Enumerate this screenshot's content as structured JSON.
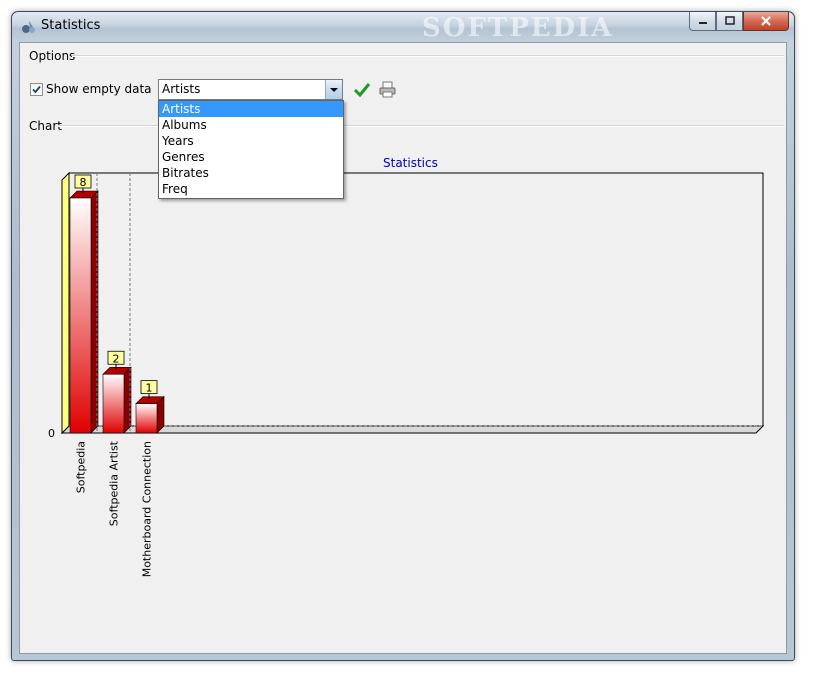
{
  "window": {
    "title": "Statistics",
    "watermark": "SOFTPEDIA"
  },
  "options": {
    "group_label": "Options",
    "show_empty_label": "Show empty data",
    "show_empty_checked": true,
    "combo_value": "Artists",
    "dropdown_items": [
      "Artists",
      "Albums",
      "Years",
      "Genres",
      "Bitrates",
      "Freq"
    ],
    "dropdown_selected": "Artists"
  },
  "chart_group": {
    "label": "Chart"
  },
  "colors": {
    "bar": "#e00000",
    "back_wall": "#ffff80",
    "title": "#0000c0",
    "selection": "#3399ff"
  },
  "chart_data": {
    "type": "bar",
    "title": "Statistics",
    "categories": [
      "Softpedia",
      "Softpedia Artist",
      "Motherboard Connection"
    ],
    "values": [
      8,
      2,
      1
    ],
    "ytick_labels": [
      "0"
    ],
    "ylim": [
      0,
      8
    ],
    "grid": false,
    "legend": "none"
  }
}
